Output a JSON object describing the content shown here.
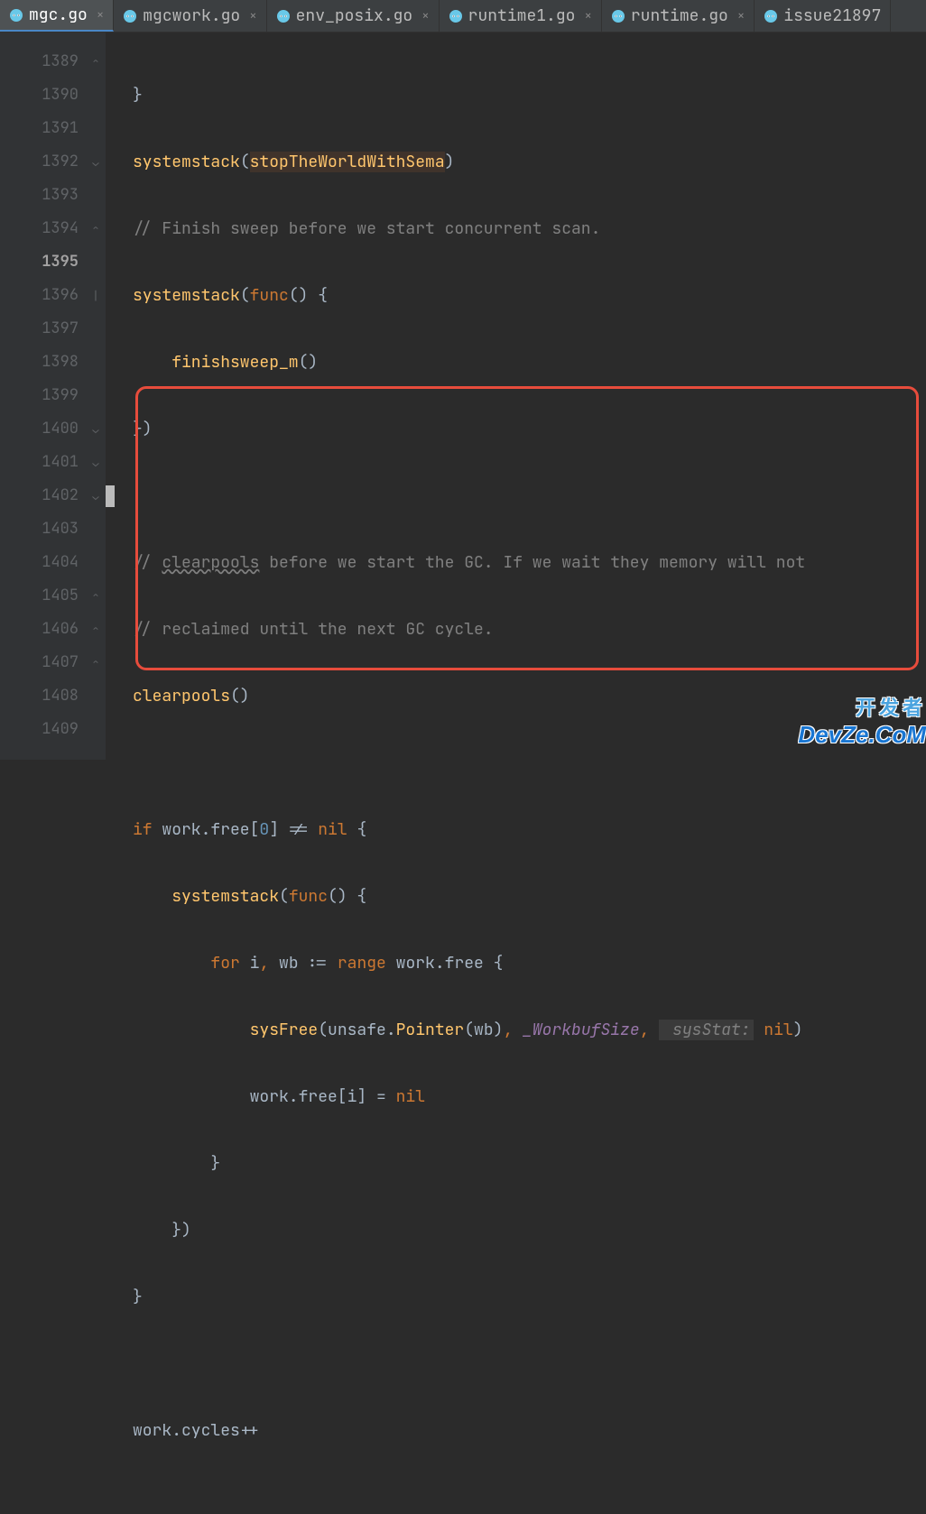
{
  "tabs": [
    {
      "label": "mgc.go",
      "active": true
    },
    {
      "label": "mgcwork.go",
      "active": false
    },
    {
      "label": "env_posix.go",
      "active": false
    },
    {
      "label": "runtime1.go",
      "active": false
    },
    {
      "label": "runtime.go",
      "active": false
    },
    {
      "label": "issue21897",
      "active": false
    }
  ],
  "line_start": 1389,
  "line_end": 1409,
  "current_line": 1395,
  "code": {
    "l1389": {
      "brace": "}"
    },
    "l1390": {
      "fn": "systemstack",
      "arg": "stopTheWorldWithSema"
    },
    "l1391": {
      "comment": "// Finish sweep before we start concurrent scan."
    },
    "l1392": {
      "fn": "systemstack",
      "kw": "func",
      "rest": "() {"
    },
    "l1393": {
      "fn": "finishsweep_m",
      "rest": "()"
    },
    "l1394": {
      "close": "})"
    },
    "l1395": {
      "cursor": true
    },
    "l1396": {
      "pre": "// ",
      "u": "clearpools",
      "post": " before we start the GC. If we wait they memory will not"
    },
    "l1397": {
      "comment": "// reclaimed until the next GC cycle."
    },
    "l1398": {
      "fn": "clearpools",
      "rest": "()"
    },
    "l1399": {
      "blank": true
    },
    "l1400": {
      "kw": "if",
      "txt1": " work.free[",
      "num": "0",
      "txt2": "] != ",
      "nil": "nil",
      "txt3": " {"
    },
    "l1401": {
      "fn": "systemstack",
      "txt1": "(",
      "kw": "func",
      "txt2": "() {"
    },
    "l1402": {
      "kw": "for",
      "txt1": " i",
      "punct": ",",
      "txt2": " wb := ",
      "kw2": "range",
      "txt3": " work.free {"
    },
    "l1403": {
      "fn": "sysFree",
      "txt1": "(unsafe.",
      "fn2": "Pointer",
      "txt2": "(wb)",
      "punct": ",",
      "it": " _WorkbufSize",
      "punct2": ",",
      "param": " sysStat:",
      "nil": " nil",
      "txt3": ")"
    },
    "l1404": {
      "txt1": "work.free[i] = ",
      "nil": "nil"
    },
    "l1405": {
      "brace": "}"
    },
    "l1406": {
      "close": "})"
    },
    "l1407": {
      "brace": "}"
    },
    "l1408": {
      "blank": true
    },
    "l1409": {
      "txt": "work.cycles++"
    }
  },
  "watermark": {
    "cn": "开发者",
    "en": "DevZe.CoM"
  }
}
